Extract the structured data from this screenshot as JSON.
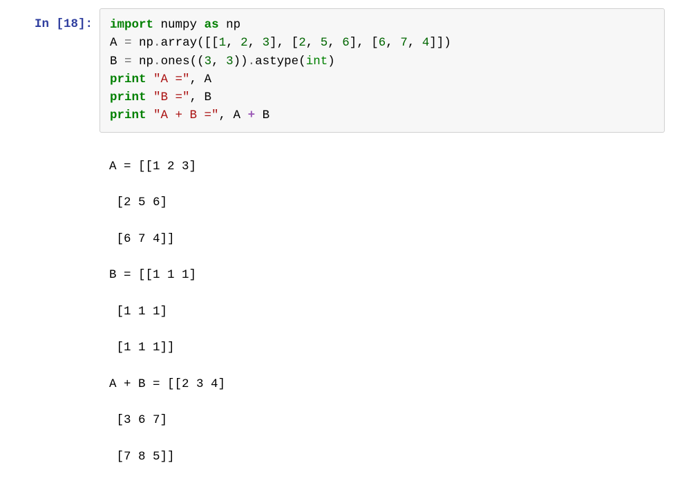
{
  "cell": {
    "prompt_label": "In ",
    "prompt_open": "[",
    "prompt_num": "18",
    "prompt_close": "]:",
    "code": {
      "l1_kw_import": "import",
      "l1_sp1": " ",
      "l1_numpy": "numpy",
      "l1_sp2": " ",
      "l1_kw_as": "as",
      "l1_sp3": " ",
      "l1_np": "np",
      "blank": "",
      "l3_a": "A ",
      "l3_eq": "=",
      "l3_b": " np",
      "l3_dot1": ".",
      "l3_array": "array",
      "l3_op1": "([[",
      "l3_n1": "1",
      "l3_c1": ", ",
      "l3_n2": "2",
      "l3_c2": ", ",
      "l3_n3": "3",
      "l3_mid1": "], [",
      "l3_n4": "2",
      "l3_c3": ", ",
      "l3_n5": "5",
      "l3_c4": ", ",
      "l3_n6": "6",
      "l3_mid2": "], [",
      "l3_n7": "6",
      "l3_c5": ", ",
      "l3_n8": "7",
      "l3_c6": ", ",
      "l3_n9": "4",
      "l3_end": "]])",
      "l4_a": "B ",
      "l4_eq": "=",
      "l4_b": " np",
      "l4_dot1": ".",
      "l4_ones": "ones",
      "l4_op": "((",
      "l4_n1": "3",
      "l4_c1": ", ",
      "l4_n2": "3",
      "l4_cp": "))",
      "l4_dot2": ".",
      "l4_astype": "astype(",
      "l4_int": "int",
      "l4_close": ")",
      "l5_print": "print",
      "l5_sp": " ",
      "l5_str": "\"A =\"",
      "l5_c": ", A",
      "l6_print": "print",
      "l6_sp": " ",
      "l6_str": "\"B =\"",
      "l6_c": ", B",
      "l7_print": "print",
      "l7_sp": " ",
      "l7_str": "\"A + B =\"",
      "l7_c1": ", A ",
      "l7_plus": "+",
      "l7_c2": " B"
    }
  },
  "output": {
    "l1": "A = [[1 2 3]",
    "l2": " [2 5 6]",
    "l3": " [6 7 4]]",
    "l4": "B = [[1 1 1]",
    "l5": " [1 1 1]",
    "l6": " [1 1 1]]",
    "l7": "A + B = [[2 3 4]",
    "l8": " [3 6 7]",
    "l9": " [7 8 5]]"
  }
}
